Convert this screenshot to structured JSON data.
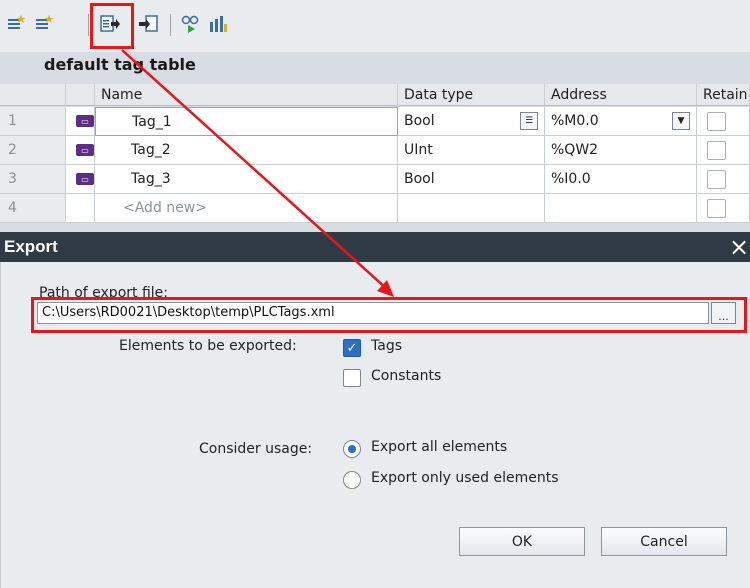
{
  "toolbar": {
    "buttons": [
      {
        "icon": "add-tag-icon"
      },
      {
        "icon": "insert-tag-icon"
      },
      {
        "icon": "export-icon"
      },
      {
        "icon": "import-icon"
      },
      {
        "icon": "monitor-all-icon"
      },
      {
        "icon": "show-usage-icon"
      }
    ]
  },
  "table": {
    "title": "default tag table",
    "columns": [
      "Name",
      "Data type",
      "Address",
      "Retain"
    ],
    "rows": [
      {
        "num": "1",
        "name": "Tag_1",
        "type": "Bool",
        "address": "%M0.0"
      },
      {
        "num": "2",
        "name": "Tag_2",
        "type": "UInt",
        "address": "%QW2"
      },
      {
        "num": "3",
        "name": "Tag_3",
        "type": "Bool",
        "address": "%I0.0"
      }
    ],
    "add_row": {
      "num": "4",
      "name": "<Add new>"
    },
    "tag_icon_text": "◁ul"
  },
  "dialog": {
    "title": "Export",
    "close": "×",
    "path_label": "Path of export file:",
    "path_value": "C:\\Users\\RD0021\\Desktop\\temp\\PLCTags.xml",
    "browse_label": "...",
    "elements_label": "Elements to be exported:",
    "tags_label": "Tags",
    "constants_label": "Constants",
    "usage_label": "Consider usage:",
    "export_all_label": "Export all elements",
    "export_used_label": "Export only used elements",
    "ok_label": "OK",
    "cancel_label": "Cancel",
    "tags_checked": true,
    "constants_checked": false,
    "usage_selected": "Export all elements"
  },
  "colors": {
    "highlight": "#e8161a",
    "accent": "#2c6fc7",
    "title_bar": "#2f3a45"
  }
}
